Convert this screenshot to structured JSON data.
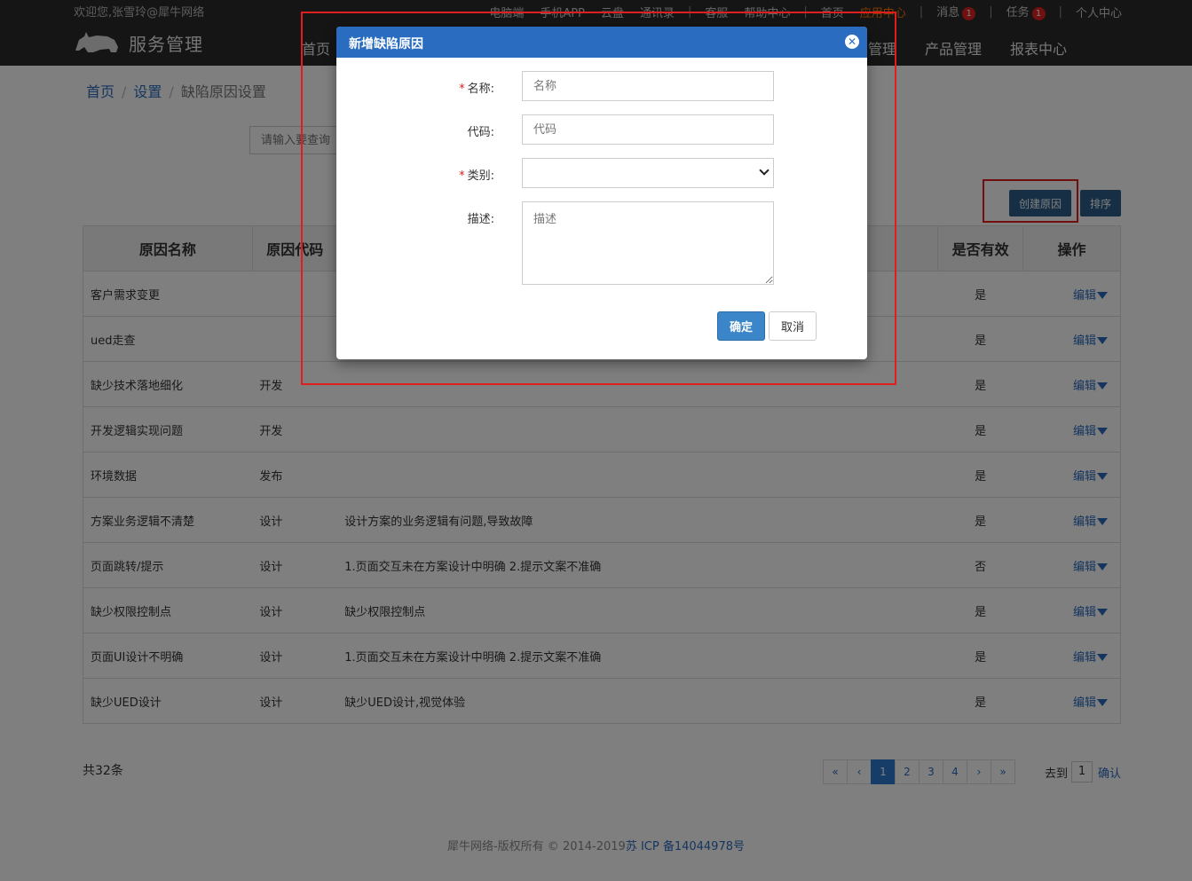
{
  "topbar": {
    "welcome": "欢迎您,张雪玲@犀牛网络",
    "links": [
      "电脑端",
      "手机APP",
      "云盘",
      "通讯录",
      "客服",
      "帮助中心",
      "首页",
      "应用中心",
      "消息",
      "任务",
      "个人中心"
    ],
    "message_count": "1",
    "task_count": "1",
    "brand": "服务管理",
    "nav": [
      "首页",
      "管理",
      "产品管理",
      "报表中心"
    ]
  },
  "breadcrumb": {
    "home": "首页",
    "settings": "设置",
    "current": "缺陷原因设置",
    "sep": "/"
  },
  "search": {
    "placeholder": "请输入要查询"
  },
  "toolbar": {
    "create_label": "创建原因",
    "sort_label": "排序"
  },
  "table": {
    "headers": [
      "原因名称",
      "原因代码",
      "",
      "是否有效",
      "操作"
    ],
    "edit_label": "编辑",
    "rows": [
      {
        "name": "客户需求变更",
        "code": "",
        "desc": "",
        "valid": "是"
      },
      {
        "name": "ued走查",
        "code": "",
        "desc": "",
        "valid": "是"
      },
      {
        "name": "缺少技术落地细化",
        "code": "开发",
        "desc": "",
        "valid": "是"
      },
      {
        "name": "开发逻辑实现问题",
        "code": "开发",
        "desc": "",
        "valid": "是"
      },
      {
        "name": "环境数据",
        "code": "发布",
        "desc": "",
        "valid": "是"
      },
      {
        "name": "方案业务逻辑不清楚",
        "code": "设计",
        "desc": "设计方案的业务逻辑有问题,导致故障",
        "valid": "是"
      },
      {
        "name": "页面跳转/提示",
        "code": "设计",
        "desc": "1.页面交互未在方案设计中明确 2.提示文案不准确",
        "valid": "否"
      },
      {
        "name": "缺少权限控制点",
        "code": "设计",
        "desc": "缺少权限控制点",
        "valid": "是"
      },
      {
        "name": "页面UI设计不明确",
        "code": "设计",
        "desc": "1.页面交互未在方案设计中明确 2.提示文案不准确",
        "valid": "是"
      },
      {
        "name": "缺少UED设计",
        "code": "设计",
        "desc": "缺少UED设计,视觉体验",
        "valid": "是"
      }
    ]
  },
  "pagination": {
    "total": "共32条",
    "pages": [
      "«",
      "‹",
      "1",
      "2",
      "3",
      "4",
      "›",
      "»"
    ],
    "current": "1",
    "goto_label": "去到",
    "goto_value": "1",
    "confirm_label": "确认"
  },
  "footer": {
    "copyright": "犀牛网络-版权所有 © 2014-2019",
    "icp": "苏 ICP 备14044978号"
  },
  "modal": {
    "title": "新增缺陷原因",
    "fields": {
      "name_label": "名称:",
      "name_placeholder": "名称",
      "code_label": "代码:",
      "code_placeholder": "代码",
      "type_label": "类别:",
      "desc_label": "描述:",
      "desc_placeholder": "描述"
    },
    "ok_label": "确定",
    "cancel_label": "取消"
  },
  "colors": {
    "primary": "#2a6dc0",
    "highlight": "#e01e1e",
    "active_link": "#ff7a00",
    "badge": "#e02020"
  }
}
